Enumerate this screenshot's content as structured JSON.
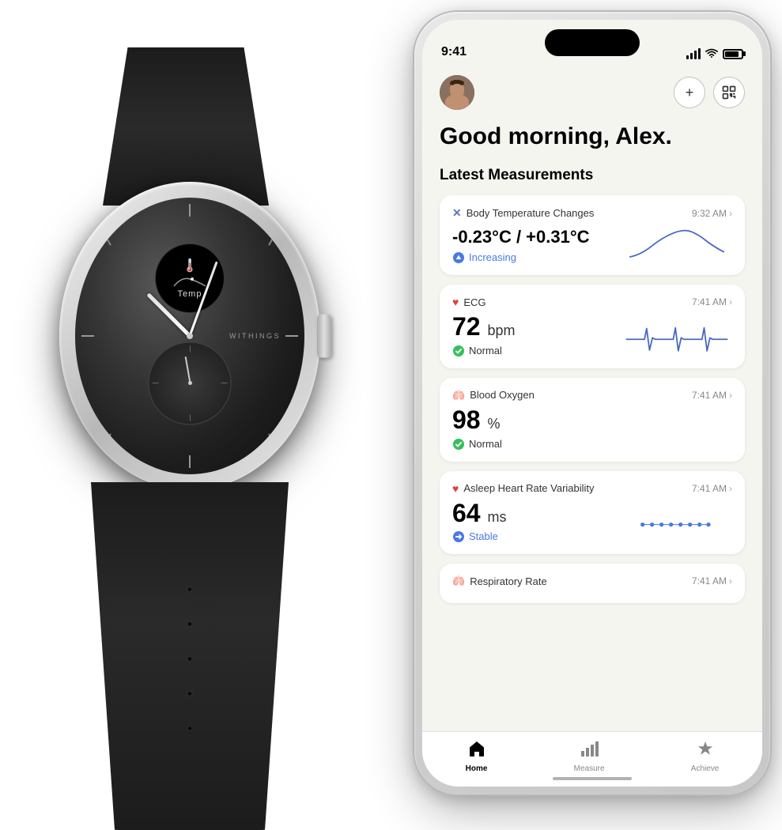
{
  "watch": {
    "brand": "WITHINGS",
    "display_label": "Temp"
  },
  "phone": {
    "status_bar": {
      "time": "9:41"
    },
    "greeting": "Good morning, Alex.",
    "section_title": "Latest Measurements",
    "measurements": [
      {
        "id": "body-temp",
        "icon": "✕",
        "icon_type": "temp-icon",
        "title": "Body Temperature Changes",
        "time": "9:32 AM",
        "value": "-0.23°C / +0.31°C",
        "status": "Increasing",
        "status_icon": "arrow-up-circle",
        "chart_type": "curve"
      },
      {
        "id": "ecg",
        "icon": "♥",
        "icon_type": "heart",
        "title": "ECG",
        "time": "7:41 AM",
        "value": "72",
        "unit": "bpm",
        "status": "Normal",
        "status_icon": "check-circle",
        "chart_type": "ecg"
      },
      {
        "id": "blood-oxygen",
        "icon": "🫁",
        "icon_type": "lung",
        "title": "Blood Oxygen",
        "time": "7:41 AM",
        "value": "98",
        "unit": "%",
        "status": "Normal",
        "status_icon": "check-circle",
        "chart_type": "none"
      },
      {
        "id": "hrv",
        "icon": "♥",
        "icon_type": "heart",
        "title": "Asleep Heart Rate Variability",
        "time": "7:41 AM",
        "value": "64",
        "unit": "ms",
        "status": "Stable",
        "status_icon": "arrow-stable",
        "chart_type": "dots"
      },
      {
        "id": "respiratory",
        "icon": "🫁",
        "icon_type": "lung",
        "title": "Respiratory Rate",
        "time": "7:41 AM",
        "value": "",
        "unit": "",
        "status": "",
        "chart_type": "partial"
      }
    ],
    "tabs": [
      {
        "id": "home",
        "label": "Home",
        "icon": "house",
        "active": true
      },
      {
        "id": "measure",
        "label": "Measure",
        "icon": "chart",
        "active": false
      },
      {
        "id": "achieve",
        "label": "Achieve",
        "icon": "star",
        "active": false
      }
    ]
  }
}
